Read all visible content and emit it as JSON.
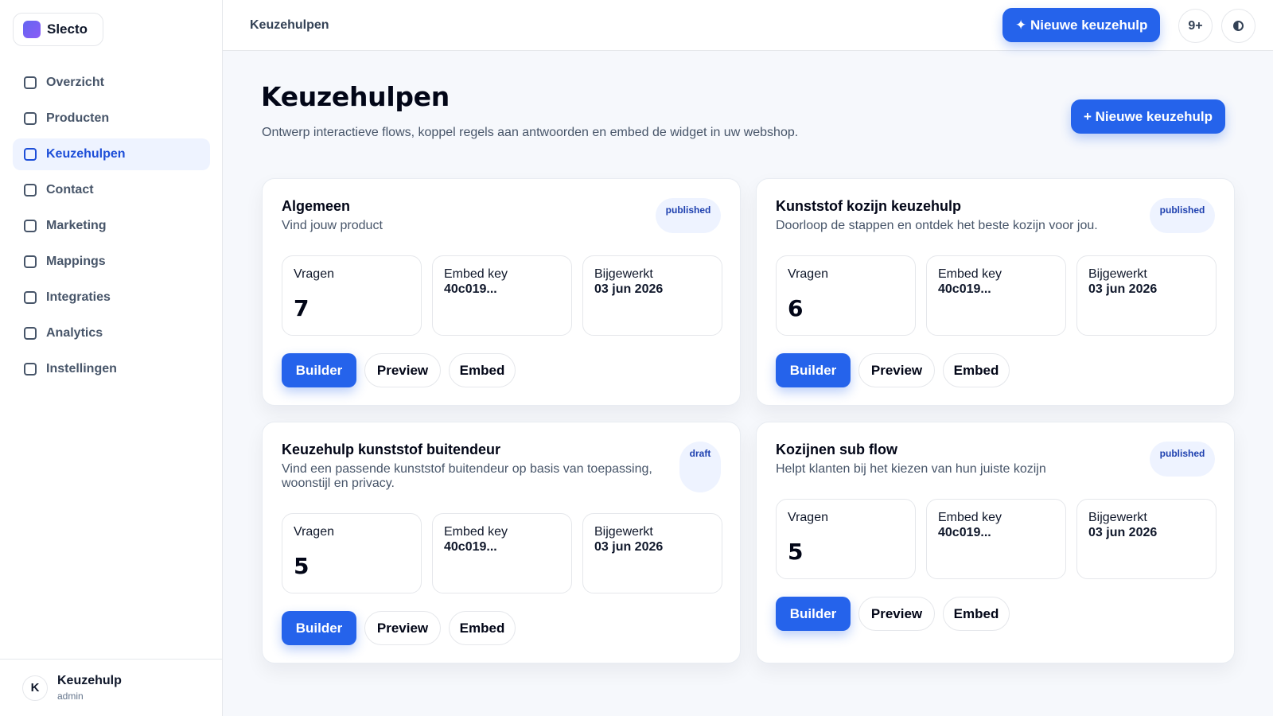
{
  "app": {
    "name": "Slecto"
  },
  "sidebar": {
    "items": [
      {
        "label": "Overzicht"
      },
      {
        "label": "Producten"
      },
      {
        "label": "Keuzehulpen"
      },
      {
        "label": "Contact"
      },
      {
        "label": "Marketing"
      },
      {
        "label": "Mappings"
      },
      {
        "label": "Integraties"
      },
      {
        "label": "Analytics"
      },
      {
        "label": "Instellingen"
      }
    ],
    "active_index": 2,
    "user": {
      "initial": "K",
      "name": "Keuzehulp",
      "role": "admin"
    }
  },
  "topbar": {
    "breadcrumb": "Keuzehulpen",
    "new_button": "✦ Nieuwe keuzehulp",
    "notifications": "9+"
  },
  "page": {
    "title": "Keuzehulpen",
    "subtitle": "Ontwerp interactieve flows, koppel regels aan antwoorden en embed de widget in uw webshop.",
    "new_button": "+ Nieuwe keuzehulp"
  },
  "labels": {
    "questions": "Vragen",
    "embed_key": "Embed key",
    "updated": "Bijgewerkt",
    "builder": "Builder",
    "preview": "Preview",
    "embed": "Embed"
  },
  "cards": [
    {
      "title": "Algemeen",
      "description": "Vind jouw product",
      "status": "published",
      "questions": "7",
      "embed_key": "40c019...",
      "updated": "03 jun 2026"
    },
    {
      "title": "Kunststof kozijn keuzehulp",
      "description": "Doorloop de stappen en ontdek het beste kozijn voor jou.",
      "status": "published",
      "questions": "6",
      "embed_key": "40c019...",
      "updated": "03 jun 2026"
    },
    {
      "title": "Keuzehulp kunststof buitendeur",
      "description": "Vind een passende kunststof buitendeur op basis van toepassing, woonstijl en privacy.",
      "status": "draft",
      "questions": "5",
      "embed_key": "40c019...",
      "updated": "03 jun 2026"
    },
    {
      "title": "Kozijnen sub flow",
      "description": "Helpt klanten bij het kiezen van hun juiste kozijn",
      "status": "published",
      "questions": "5",
      "embed_key": "40c019...",
      "updated": "03 jun 2026"
    }
  ],
  "colors": {
    "primary": "#2563eb",
    "active_nav_bg": "#eef3ff",
    "active_nav_text": "#1d4ed8",
    "status_bg": "#eef3ff"
  }
}
